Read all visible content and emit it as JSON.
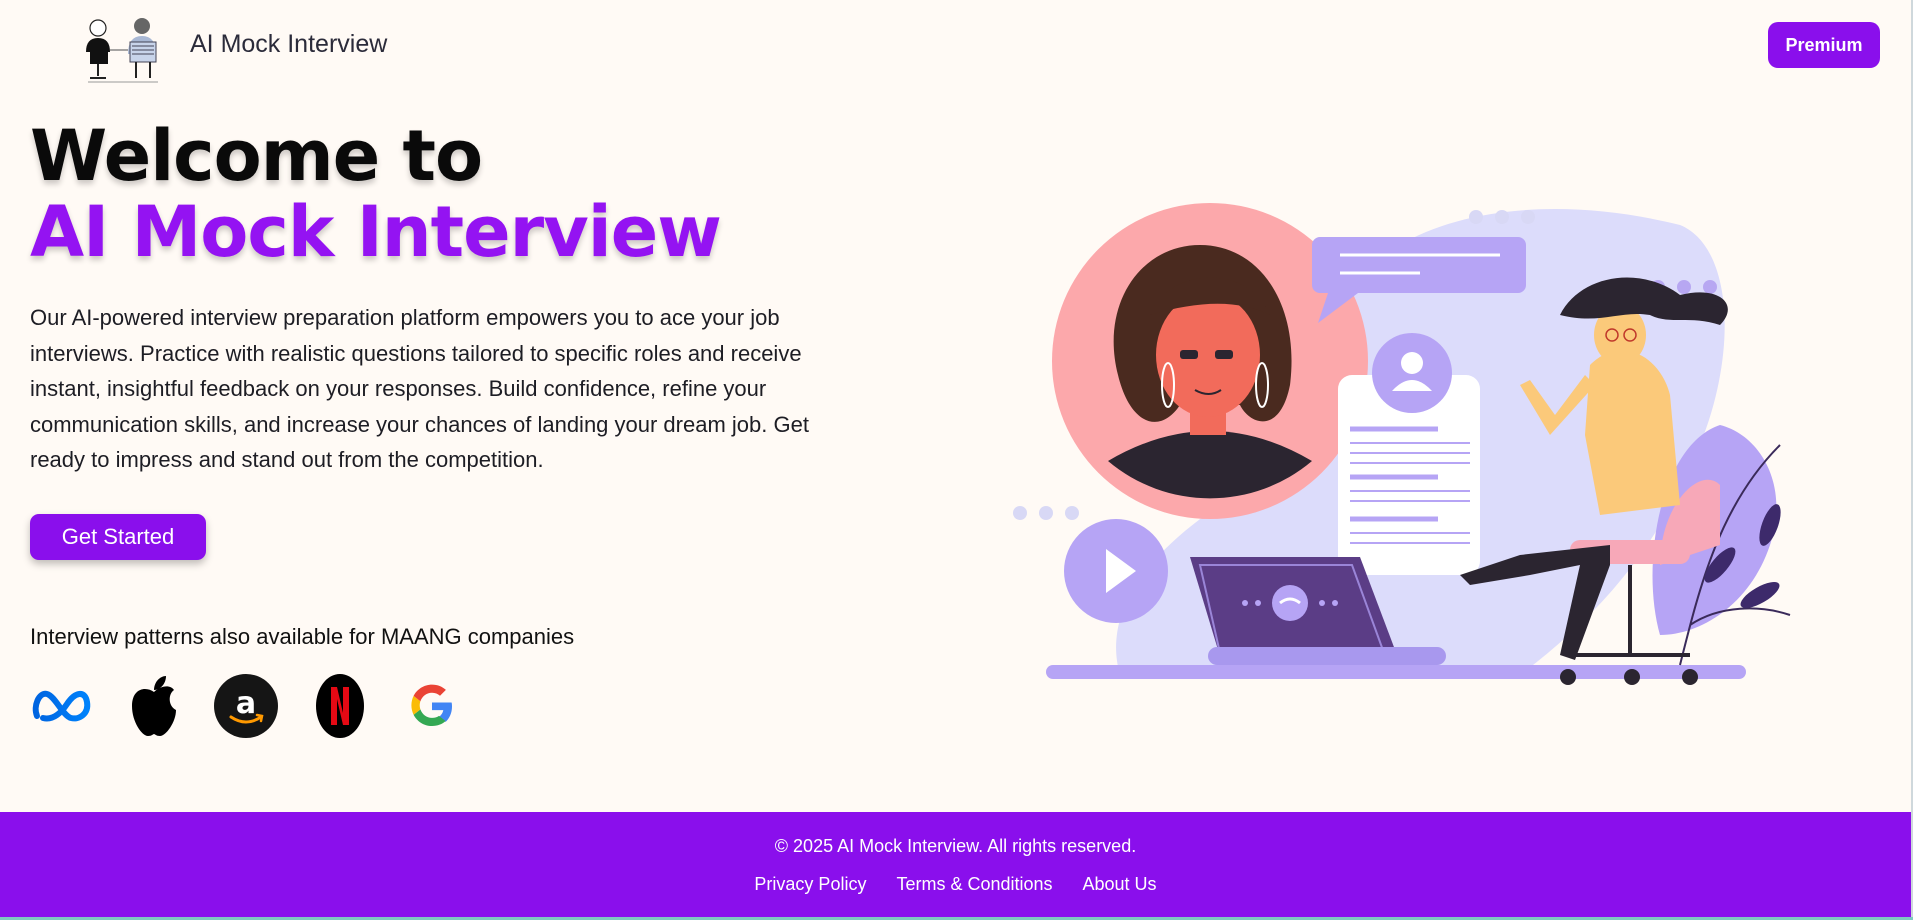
{
  "header": {
    "brand": "AI Mock Interview",
    "premium_label": "Premium",
    "logo_icon": "interview-people-logo-icon"
  },
  "hero": {
    "title_line1": "Welcome to",
    "title_line2": "AI Mock Interview",
    "description": "Our AI-powered interview preparation platform empowers you to ace your job interviews. Practice with realistic questions tailored to specific roles and receive instant, insightful feedback on your responses. Build confidence, refine your communication skills, and increase your chances of landing your dream job. Get ready to impress and stand out from the competition.",
    "cta_label": "Get Started",
    "illustration": "video-interview-illustration"
  },
  "companies": {
    "title": "Interview patterns also available for MAANG companies",
    "logos": [
      "meta-logo-icon",
      "apple-logo-icon",
      "amazon-logo-icon",
      "netflix-logo-icon",
      "google-logo-icon"
    ]
  },
  "footer": {
    "copyright": "© 2025 AI Mock Interview. All rights reserved.",
    "links": [
      "Privacy Policy",
      "Terms & Conditions",
      "About Us"
    ]
  },
  "colors": {
    "accent": "#8a0fec",
    "title_purple": "#9413f2",
    "background": "#fffaf5"
  }
}
